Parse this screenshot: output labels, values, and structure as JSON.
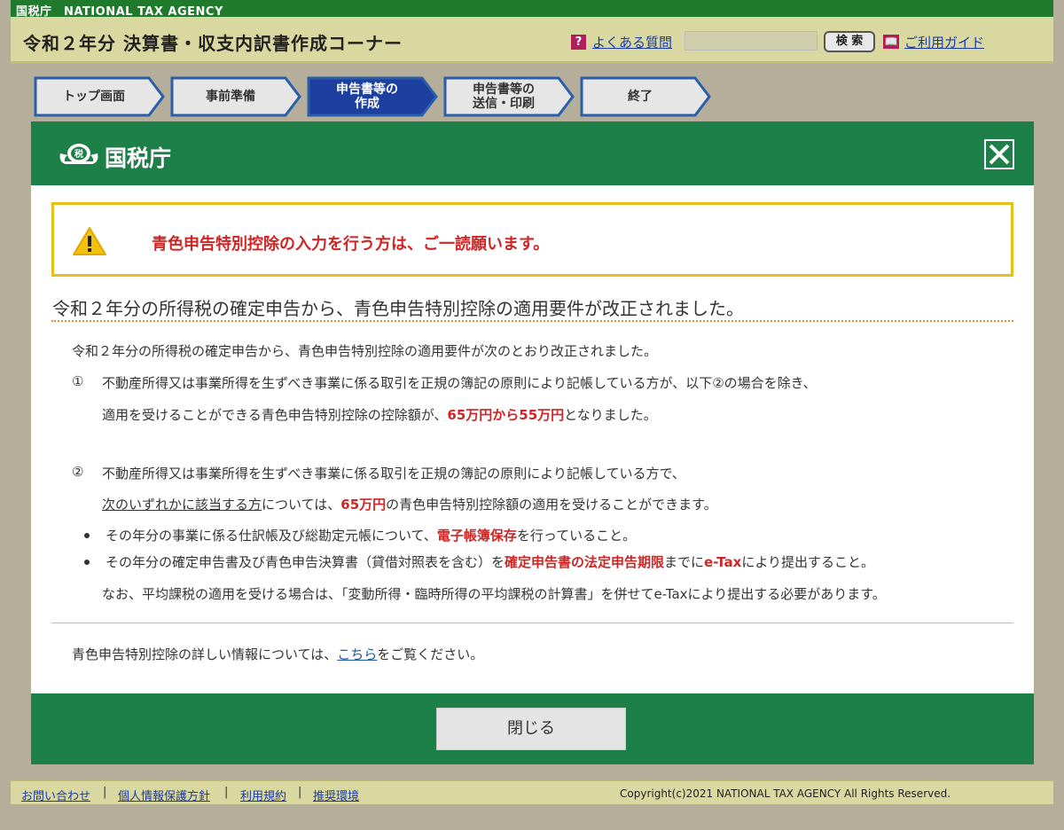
{
  "header": {
    "agency_strip": "国税庁　NATIONAL TAX AGENCY",
    "corner_title": "令和２年分 決算書・収支内訳書作成コーナー",
    "faq_label": "よくある質問",
    "search_placeholder": "",
    "search_button": "検 索",
    "guide_label": "ご利用ガイド",
    "help_icon": "question-icon",
    "guide_icon": "book-icon"
  },
  "steps": [
    {
      "label": "トップ画面",
      "active": false
    },
    {
      "label": "事前準備",
      "active": false
    },
    {
      "label": "申告書等の\n作成",
      "active": true
    },
    {
      "label": "申告書等の\n送信・印刷",
      "active": false
    },
    {
      "label": "終了",
      "active": false
    }
  ],
  "modal": {
    "title": "国税庁",
    "notice": "青色申告特別控除の入力を行う方は、ご一読願います。",
    "heading": "令和２年分の所得税の確定申告から、青色申告特別控除の適用要件が改正されました。",
    "intro": "令和２年分の所得税の確定申告から、青色申告特別控除の適用要件が次のとおり改正されました。",
    "item1_num": "①",
    "item1_line1": "不動産所得又は事業所得を生ずべき事業に係る取引を正規の簿記の原則により記帳している方が、以下②の場合を除き、",
    "item1_line2_pre": "適用を受けることができる青色申告特別控除の控除額が、",
    "item1_line2_red": "65万円から55万円",
    "item1_line2_post": "となりました。",
    "item2_num": "②",
    "item2_line1": "不動産所得又は事業所得を生ずべき事業に係る取引を正規の簿記の原則により記帳している方で、",
    "item2_line2_u": "次のいずれかに該当する方",
    "item2_line2_mid": "については、",
    "item2_line2_red": "65万円",
    "item2_line2_post": "の青色申告特別控除額の適用を受けることができます。",
    "bullet1_pre": "その年分の事業に係る仕訳帳及び総勘定元帳について、",
    "bullet1_red": "電子帳簿保存",
    "bullet1_post": "を行っていること。",
    "bullet2_pre": "その年分の確定申告書及び青色申告決算書（貸借対照表を含む）を",
    "bullet2_red": "確定申告書の法定申告期限",
    "bullet2_mid": "までに",
    "bullet2_red2": "e-Tax",
    "bullet2_post": "により提出すること。",
    "note": "なお、平均課税の適用を受ける場合は、「変動所得・臨時所得の平均課税の計算書」を併せてe-Taxにより提出する必要があります。",
    "more_pre": "青色申告特別控除の詳しい情報については、",
    "more_link": "こちら",
    "more_post": "をご覧ください。",
    "close_button": "閉じる"
  },
  "footer": {
    "links": [
      "お問い合わせ",
      "個人情報保護方針",
      "利用規約",
      "推奨環境"
    ],
    "separator": "|",
    "copyright": "Copyright(c)2021 NATIONAL TAX AGENCY All Rights Reserved."
  }
}
